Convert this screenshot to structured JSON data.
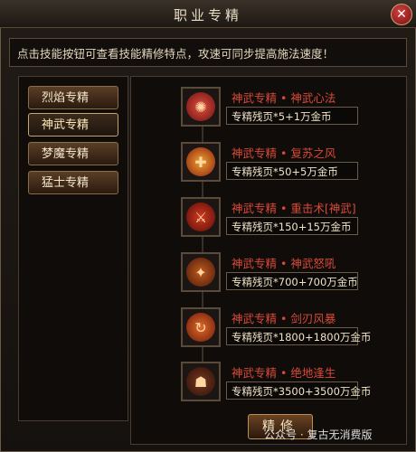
{
  "window": {
    "title": "职业专精",
    "close_icon": "close-icon"
  },
  "hint": "点击技能按钮可查看技能精修特点，攻速可同步提高施法速度！",
  "tabs": [
    {
      "label": "烈焰专精",
      "active": false
    },
    {
      "label": "神武专精",
      "active": true
    },
    {
      "label": "梦魔专精",
      "active": false
    },
    {
      "label": "猛士专精",
      "active": false
    }
  ],
  "skills": [
    {
      "name": "神武专精 • 神武心法",
      "cost": "专精残页*5+1万金币",
      "icon": "rune-icon",
      "color": "#b8322a"
    },
    {
      "name": "神武专精 • 复苏之风",
      "cost": "专精残页*50+5万金币",
      "icon": "revive-icon",
      "color": "#c8491a"
    },
    {
      "name": "神武专精 • 重击术[神武]",
      "cost": "专精残页*150+15万金币",
      "icon": "heavy-strike-icon",
      "color": "#9a2418"
    },
    {
      "name": "神武专精 • 神武怒吼",
      "cost": "专精残页*700+700万金币",
      "icon": "roar-icon",
      "color": "#8a3a1a"
    },
    {
      "name": "神武专精 • 剑刃风暴",
      "cost": "专精残页*1800+1800万金币",
      "icon": "blade-storm-icon",
      "color": "#b2401c"
    },
    {
      "name": "神武专精 • 绝地逢生",
      "cost": "专精残页*3500+3500万金币",
      "icon": "last-stand-icon",
      "color": "#5a2a1a"
    }
  ],
  "action_button": "精修",
  "watermark": "公众号 · 复古无消费版"
}
